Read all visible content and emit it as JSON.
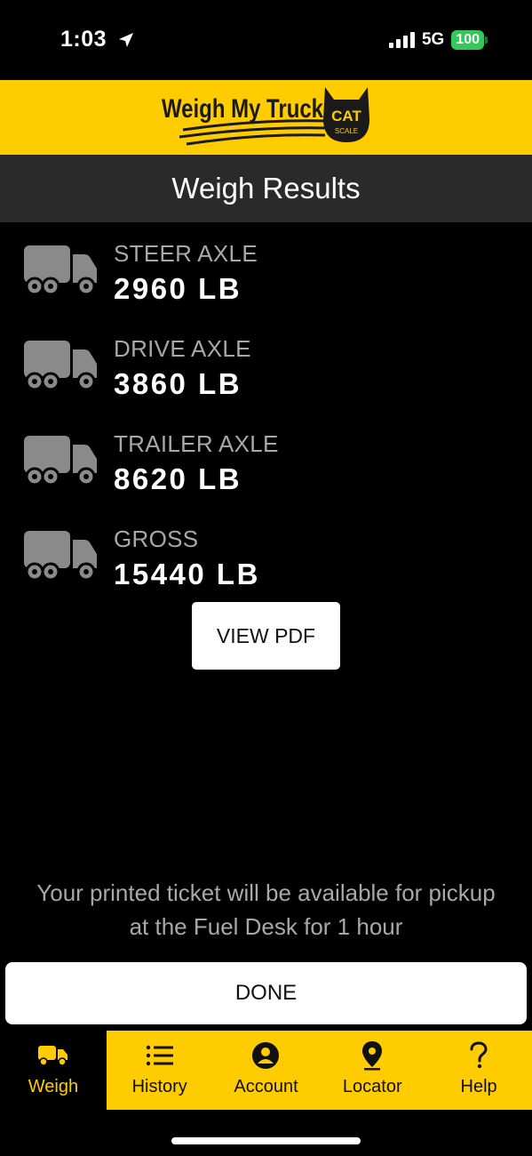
{
  "status_bar": {
    "time": "1:03",
    "network": "5G",
    "battery": "100"
  },
  "brand": {
    "logo_text": "Weigh My Truck",
    "badge_text": "CAT",
    "badge_sub": "SCALE"
  },
  "header": {
    "title": "Weigh Results"
  },
  "results": [
    {
      "label": "STEER AXLE",
      "value": "2960 LB"
    },
    {
      "label": "DRIVE AXLE",
      "value": "3860 LB"
    },
    {
      "label": "TRAILER AXLE",
      "value": "8620 LB"
    },
    {
      "label": "GROSS",
      "value": "15440 LB"
    }
  ],
  "actions": {
    "view_pdf": "VIEW PDF",
    "done": "DONE"
  },
  "ticket_note": "Your printed ticket will be available for pickup at the Fuel Desk for 1 hour",
  "tabs": [
    {
      "label": "Weigh",
      "icon": "truck-icon",
      "active": true
    },
    {
      "label": "History",
      "icon": "list-icon",
      "active": false
    },
    {
      "label": "Account",
      "icon": "account-icon",
      "active": false
    },
    {
      "label": "Locator",
      "icon": "location-pin-icon",
      "active": false
    },
    {
      "label": "Help",
      "icon": "question-icon",
      "active": false
    }
  ],
  "colors": {
    "brand_yellow": "#ffcc00",
    "background": "#000000",
    "header_bar": "#2a2a2a",
    "label_gray": "#a8a8a8",
    "battery_green": "#34c759"
  }
}
